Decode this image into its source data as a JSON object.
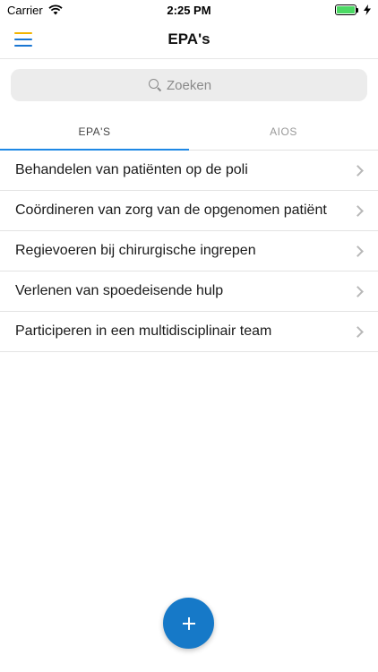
{
  "status_bar": {
    "carrier": "Carrier",
    "time": "2:25 PM",
    "battery_level": 1.0
  },
  "nav": {
    "title": "EPA's",
    "menu_icon": "hamburger-menu-icon"
  },
  "search": {
    "placeholder": "Zoeken",
    "value": ""
  },
  "tabs": [
    {
      "label": "EPA'S",
      "active": true
    },
    {
      "label": "AIOS",
      "active": false
    }
  ],
  "items": [
    {
      "label": "Behandelen van patiënten op de poli"
    },
    {
      "label": "Coördineren van zorg van de opgenomen patiënt"
    },
    {
      "label": "Regievoeren bij chirurgische ingrepen"
    },
    {
      "label": "Verlenen van spoedeisende hulp"
    },
    {
      "label": "Participeren in een multidisciplinair team"
    }
  ],
  "colors": {
    "accent": "#1e88e5",
    "fab": "#1679c8",
    "menu_top": "#f2b400"
  }
}
